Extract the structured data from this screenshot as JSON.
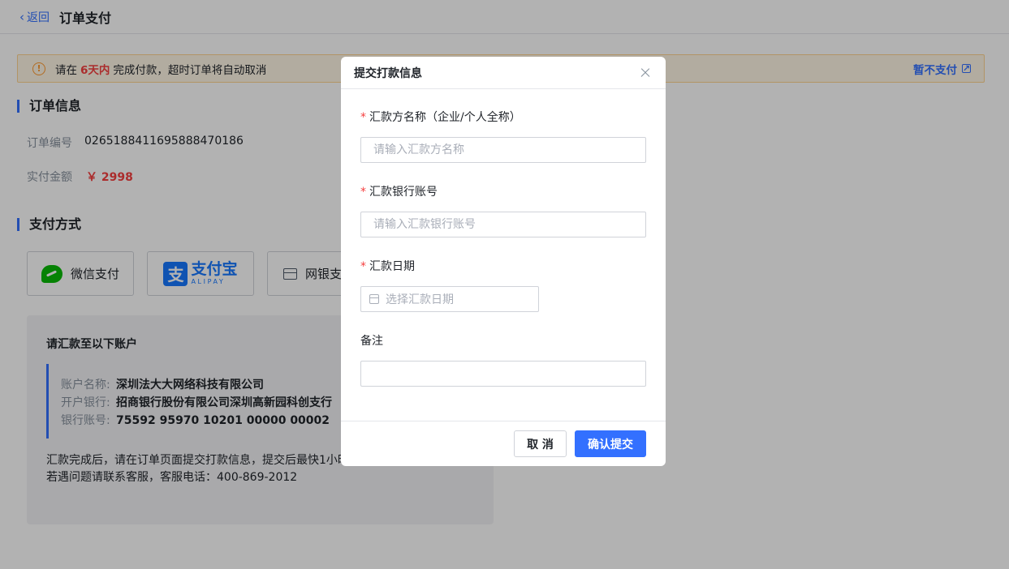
{
  "header": {
    "back_label": "返回",
    "title": "订单支付"
  },
  "notice": {
    "prefix": "请在",
    "highlight": "6天内",
    "suffix": "完成付款，超时订单将自动取消",
    "action_label": "暂不支付"
  },
  "order_info": {
    "section_title": "订单信息",
    "order_no_label": "订单编号",
    "order_no": "0265188411695888470186",
    "amount_label": "实付金额",
    "amount": "￥ 2998"
  },
  "payment": {
    "section_title": "支付方式",
    "methods": [
      {
        "label": "微信支付",
        "icon": "wechat-icon"
      },
      {
        "label": "支付宝",
        "sub": "ALIPAY",
        "icon": "alipay-icon"
      },
      {
        "label": "网银支",
        "icon": "bank-card-icon"
      }
    ]
  },
  "account": {
    "title": "请汇款至以下账户",
    "name_label": "账户名称:",
    "name": "深圳法大大网络科技有限公司",
    "bank_label": "开户银行:",
    "bank": "招商银行股份有限公司深圳高新园科创支行",
    "number_label": "银行账号:",
    "number": "75592 95970 10201 00000 00002",
    "note_line1": "汇款完成后，请在订单页面提交打款信息，提交后最快1小时",
    "note_line2": "若遇问题请联系客服，客服电话：400-869-2012"
  },
  "modal": {
    "title": "提交打款信息",
    "fields": {
      "payer_name_label": "汇款方名称（企业/个人全称）",
      "payer_name_placeholder": "请输入汇款方名称",
      "account_label": "汇款银行账号",
      "account_placeholder": "请输入汇款银行账号",
      "date_label": "汇款日期",
      "date_placeholder": "选择汇款日期",
      "remark_label": "备注",
      "remark_value": ""
    },
    "cancel_label": "取 消",
    "submit_label": "确认提交"
  },
  "colors": {
    "primary": "#3370ff",
    "danger": "#f53f3f",
    "warning": "#ff9a2e"
  }
}
